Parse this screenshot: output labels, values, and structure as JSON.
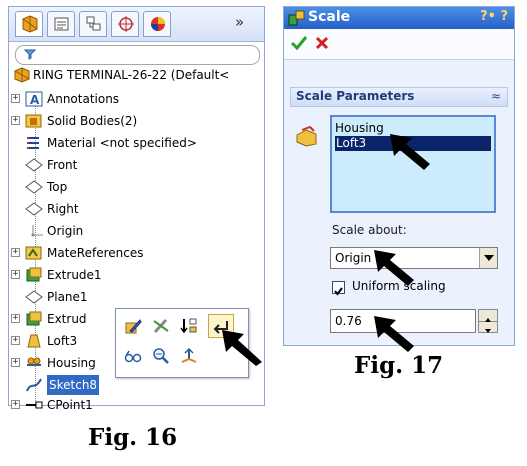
{
  "tree": {
    "tabs_overflow": "»",
    "root_label": "RING TERMINAL-26-22  (Default<",
    "items": [
      {
        "label": "Annotations"
      },
      {
        "label": "Solid Bodies(2)"
      },
      {
        "label": "Material <not specified>"
      },
      {
        "label": "Front"
      },
      {
        "label": "Top"
      },
      {
        "label": "Right"
      },
      {
        "label": "Origin"
      },
      {
        "label": "MateReferences"
      },
      {
        "label": "Extrude1"
      },
      {
        "label": "Plane1"
      },
      {
        "label": "Extrud"
      },
      {
        "label": "Loft3"
      },
      {
        "label": "Housing"
      },
      {
        "label": "Sketch8"
      },
      {
        "label": "CPoint1"
      }
    ]
  },
  "scale": {
    "title": "Scale",
    "help_icons": "?• ?",
    "group_title": "Scale Parameters",
    "collapse_glyph": "≈",
    "bodies": [
      "Housing",
      "Loft3"
    ],
    "selected_body": "Loft3",
    "scale_about_label": "Scale about:",
    "scale_about_value": "Origin",
    "uniform_scaling_label": "Uniform scaling",
    "uniform_scaling_checked": true,
    "scale_factor": "0.76"
  },
  "captions": {
    "fig16": "Fig. 16",
    "fig17": "Fig. 17"
  },
  "colors": {
    "title_blue": "#2460c8",
    "list_bg": "#ccebfd",
    "selection": "#0a246a"
  }
}
